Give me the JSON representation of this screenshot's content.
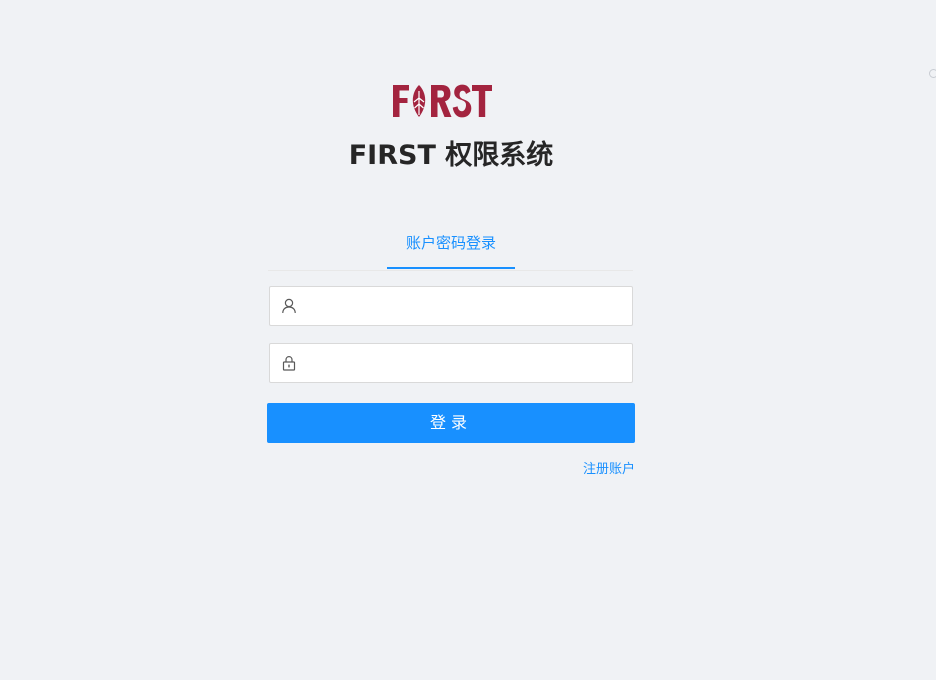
{
  "brand": {
    "logo_text": "FIRST",
    "app_title": "FIRST 权限系统",
    "logo_color": "#a3243f"
  },
  "login": {
    "tab_label": "账户密码登录",
    "username": {
      "icon": "user-icon",
      "value": "",
      "placeholder": ""
    },
    "password": {
      "icon": "lock-icon",
      "value": "",
      "placeholder": ""
    },
    "submit_label": "登录",
    "register_label": "注册账户"
  },
  "colors": {
    "primary": "#1890ff",
    "background": "#f0f2f5",
    "title": "#262626"
  }
}
